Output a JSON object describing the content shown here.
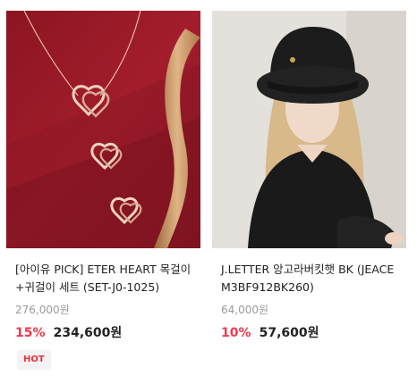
{
  "products": [
    {
      "image_alt": "eter-heart-jewelry-photo",
      "title": "[아이유 PICK] ETER HEART 목걸이+귀걸이 세트 (SET-J0-1025)",
      "original_price": "276,000원",
      "discount": "15%",
      "final_price": "234,600원",
      "badge": "HOT",
      "colors": {
        "background": "#9d1a28",
        "accent": "#f0384b"
      }
    },
    {
      "image_alt": "black-bucket-hat-model-photo",
      "title": "J.LETTER 앙고라버킷햇 BK (JEACEM3BF912BK260)",
      "original_price": "64,000원",
      "discount": "10%",
      "final_price": "57,600원",
      "colors": {
        "background": "#e4e1dc",
        "accent": "#f0384b"
      }
    }
  ]
}
